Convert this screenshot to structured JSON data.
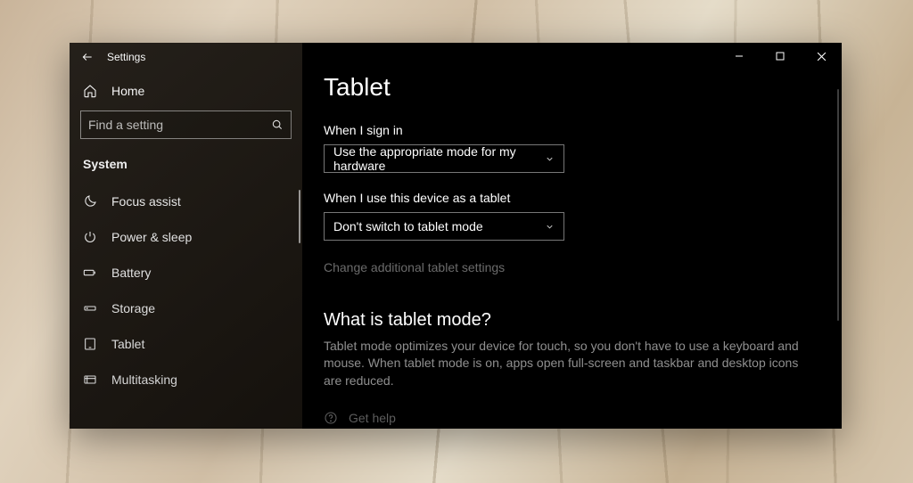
{
  "appTitle": "Settings",
  "home": "Home",
  "search": {
    "placeholder": "Find a setting"
  },
  "category": "System",
  "nav": {
    "items": [
      {
        "label": "Focus assist"
      },
      {
        "label": "Power & sleep"
      },
      {
        "label": "Battery"
      },
      {
        "label": "Storage"
      },
      {
        "label": "Tablet"
      },
      {
        "label": "Multitasking"
      }
    ]
  },
  "page": {
    "title": "Tablet",
    "signInLabel": "When I sign in",
    "signInValue": "Use the appropriate mode for my hardware",
    "tabletUseLabel": "When I use this device as a tablet",
    "tabletUseValue": "Don't switch to tablet mode",
    "advancedLink": "Change additional tablet settings",
    "whatIsHeading": "What is tablet mode?",
    "whatIsBody": "Tablet mode optimizes your device for touch, so you don't have to use a keyboard and mouse. When tablet mode is on, apps open full-screen and taskbar and desktop icons are reduced.",
    "getHelp": "Get help"
  }
}
